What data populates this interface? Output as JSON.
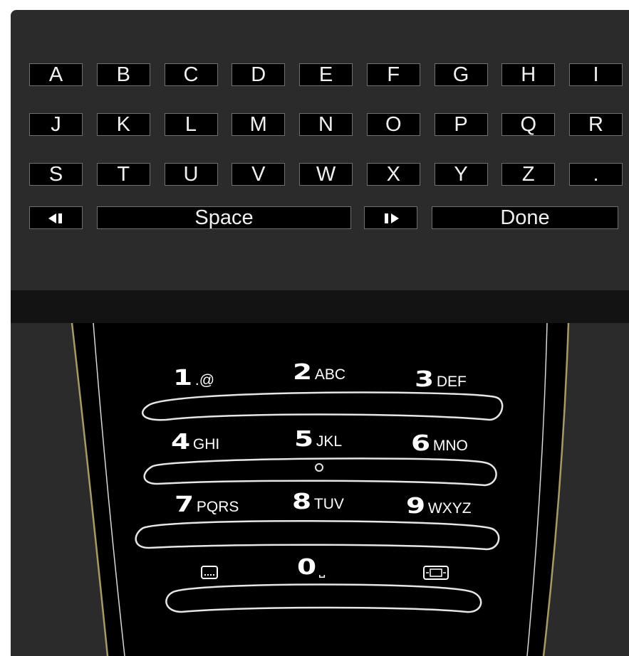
{
  "keyboard": {
    "letter_keys": [
      "A",
      "B",
      "C",
      "D",
      "E",
      "F",
      "G",
      "H",
      "I",
      "J",
      "K",
      "L",
      "M",
      "N",
      "O",
      "P",
      "Q",
      "R",
      "S",
      "T",
      "U",
      "V",
      "W",
      "X",
      "Y",
      "Z",
      "."
    ],
    "cursor_left_icon": "cursor-left-icon",
    "space_label": "Space",
    "cursor_right_icon": "cursor-right-icon",
    "done_label": "Done"
  },
  "remote": {
    "keys": [
      {
        "digit": "1",
        "letters": ".@"
      },
      {
        "digit": "2",
        "letters": "ABC"
      },
      {
        "digit": "3",
        "letters": "DEF"
      },
      {
        "digit": "4",
        "letters": "GHI"
      },
      {
        "digit": "5",
        "letters": "JKL"
      },
      {
        "digit": "6",
        "letters": "MNO"
      },
      {
        "digit": "7",
        "letters": "PQRS"
      },
      {
        "digit": "8",
        "letters": "TUV"
      },
      {
        "digit": "9",
        "letters": "WXYZ"
      },
      {
        "digit": "0",
        "letters": "⎵"
      }
    ],
    "left_icon": "subtitle-icon",
    "right_icon": "format-icon"
  },
  "colors": {
    "panel": "#2b2b2b",
    "band": "#131313",
    "key_fill": "#000000",
    "key_border": "#6f6f6f",
    "remote_body": "#000000",
    "remote_trim": "#a89a66"
  }
}
